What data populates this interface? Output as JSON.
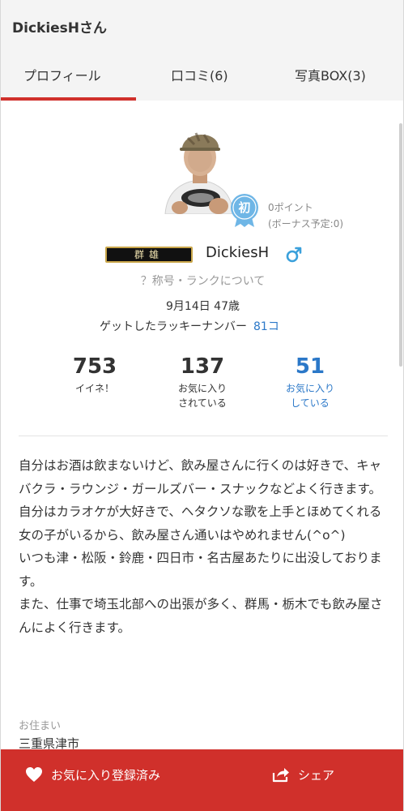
{
  "header": {
    "title": "DickiesHさん"
  },
  "tabs": [
    {
      "label": "プロフィール",
      "active": true
    },
    {
      "label": "口コミ(6)"
    },
    {
      "label": "写真BOX(3)"
    }
  ],
  "profile": {
    "first_badge": "初",
    "points": "0ポイント",
    "bonus": "(ボーナス予定:0)",
    "title_badge": "群雄",
    "username": "DickiesH",
    "gender_icon": "male-icon",
    "rank_link": "？称号・ランクについて",
    "birthday": "9月14日 47歳",
    "lucky_label": "ゲットしたラッキーナンバー",
    "lucky_value": "81コ"
  },
  "stats": {
    "likes": {
      "value": "753",
      "label": "イイネ！"
    },
    "favorited_by": {
      "value": "137",
      "label_1": "お気に入り",
      "label_2": "されている"
    },
    "favoriting": {
      "value": "51",
      "label_1": "お気に入り",
      "label_2": "している"
    }
  },
  "bio": [
    "自分はお酒は飲まないけど、飲み屋さんに行くのは好きで、キャバクラ・ラウンジ・ガールズバー・スナックなどよく行きます。",
    "自分はカラオケが大好きで、ヘタクソな歌を上手とほめてくれる女の子がいるから、飲み屋さん通いはやめれません(^o^)",
    "いつも津・松阪・鈴鹿・四日市・名古屋あたりに出没しております。",
    "また、仕事で埼玉北部への出張が多く、群馬・栃木でも飲み屋さんによく行きます。"
  ],
  "residence": {
    "label": "お住まい",
    "value": "三重県津市"
  },
  "bottom_bar": {
    "favorite_label": "お気に入り登録済み",
    "share_label": "シェア"
  },
  "colors": {
    "accent_red": "#d0302b",
    "link_blue": "#2b78c8",
    "badge_blue": "#6fb6e6",
    "background": "#f4f4f4"
  }
}
